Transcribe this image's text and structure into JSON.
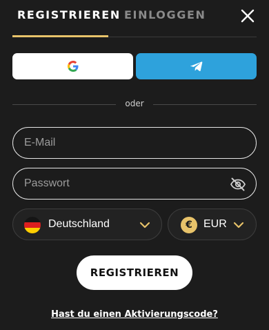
{
  "tabs": {
    "register": "REGISTRIEREN",
    "login": "EINLOGGEN",
    "active": "register",
    "accent_color": "#e8c36a"
  },
  "close_icon": "close-icon",
  "social": {
    "google_icon": "google-icon",
    "telegram_icon": "telegram-icon",
    "telegram_color": "#2ea2dc"
  },
  "divider_text": "oder",
  "form": {
    "email_placeholder": "E-Mail",
    "email_value": "",
    "password_placeholder": "Passwort",
    "password_value": "",
    "password_toggle_icon": "eye-off-icon"
  },
  "country": {
    "selected": "Deutschland",
    "flag_icon": "germany-flag-icon"
  },
  "currency": {
    "selected": "EUR",
    "symbol": "€"
  },
  "submit_label": "REGISTRIEREN",
  "activation_link": "Hast du einen Aktivierungscode?"
}
